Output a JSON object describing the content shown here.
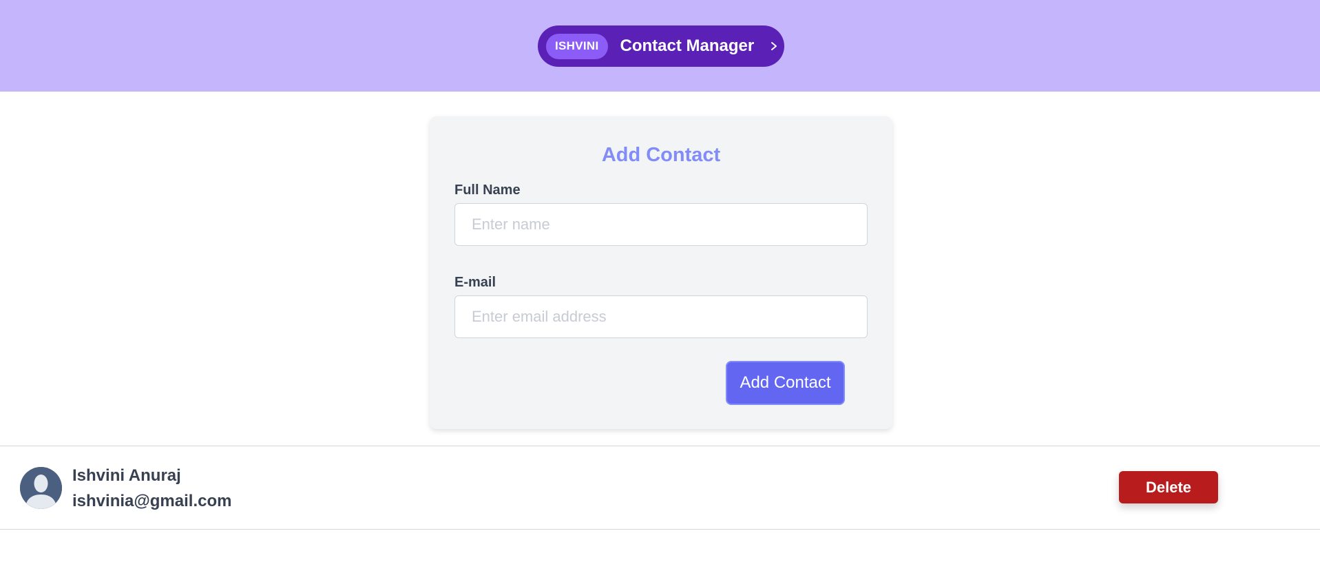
{
  "header": {
    "tag": "ISHVINI",
    "title": "Contact Manager",
    "chevron_icon": "chevron-right-icon",
    "background_color": "#c4b5fd",
    "pill_color": "#5b21b6"
  },
  "form": {
    "title": "Add Contact",
    "name_label": "Full Name",
    "name_placeholder": "Enter name",
    "name_value": "",
    "email_label": "E-mail",
    "email_placeholder": "Enter email address",
    "email_value": "",
    "submit_label": "Add Contact",
    "accent_color": "#6366f1"
  },
  "contacts": [
    {
      "avatar_icon": "user-avatar-icon",
      "name": "Ishvini Anuraj",
      "email": "ishvinia@gmail.com",
      "delete_label": "Delete",
      "delete_color": "#b91c1c"
    }
  ]
}
